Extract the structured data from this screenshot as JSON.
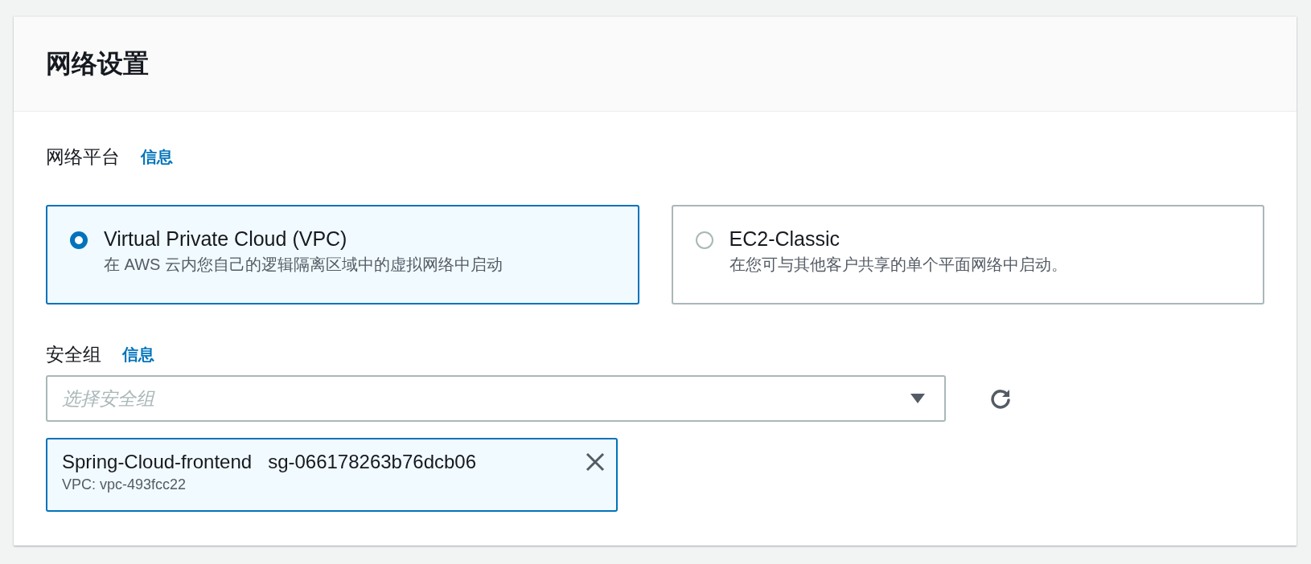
{
  "section": {
    "title": "网络设置"
  },
  "platform": {
    "label": "网络平台",
    "info_link": "信息",
    "options": [
      {
        "title": "Virtual Private Cloud (VPC)",
        "description": "在 AWS 云内您自己的逻辑隔离区域中的虚拟网络中启动",
        "selected": true
      },
      {
        "title": "EC2-Classic",
        "description": "在您可与其他客户共享的单个平面网络中启动。",
        "selected": false
      }
    ]
  },
  "security_group": {
    "label": "安全组",
    "info_link": "信息",
    "select": {
      "placeholder": "选择安全组"
    },
    "tokens": [
      {
        "name": "Spring-Cloud-frontend",
        "id": "sg-066178263b76dcb06",
        "vpc": "VPC: vpc-493fcc22"
      }
    ]
  }
}
